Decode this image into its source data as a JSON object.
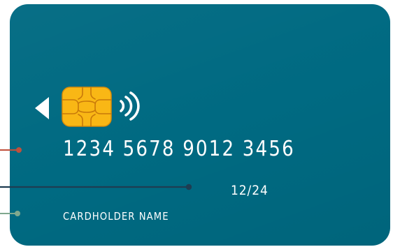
{
  "card": {
    "number": "1234 5678 9012 3456",
    "expiry": "12/24",
    "holder_name": "CARDHOLDER NAME",
    "background_color": "#006a82"
  },
  "icons": {
    "indicator": "triangle-left-icon",
    "chip": "emv-chip-icon",
    "contactless": "contactless-icon"
  },
  "callouts": {
    "number_line_color": "#c0503c",
    "expiry_line_color": "#1e3d52",
    "holder_line_color": "#7fa88e"
  }
}
